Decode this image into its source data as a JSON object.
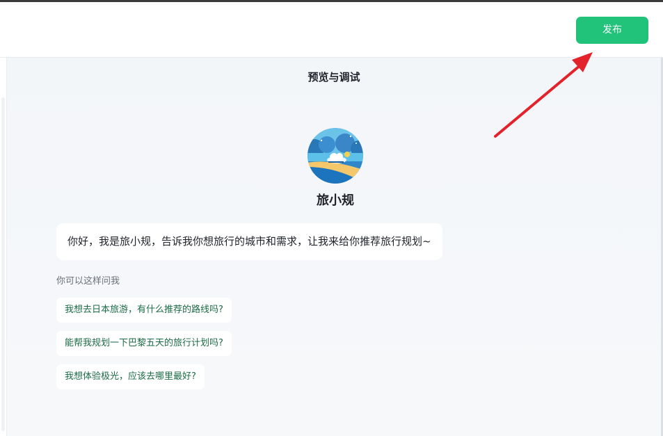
{
  "toolbar": {
    "publish_label": "发布",
    "publish_color": "#21c27a"
  },
  "preview": {
    "title": "预览与调试",
    "bot_name": "旅小规",
    "greeting": "你好，我是旅小规，告诉我你想旅行的城市和需求，让我来给你推荐旅行规划~",
    "hint": "你可以这样问我",
    "suggestions": [
      "我想去日本旅游，有什么推荐的路线吗?",
      "能帮我规划一下巴黎五天的旅行计划吗?",
      "我想体验极光，应该去哪里最好?"
    ]
  },
  "annotation": {
    "arrow_color": "#e3232c"
  }
}
